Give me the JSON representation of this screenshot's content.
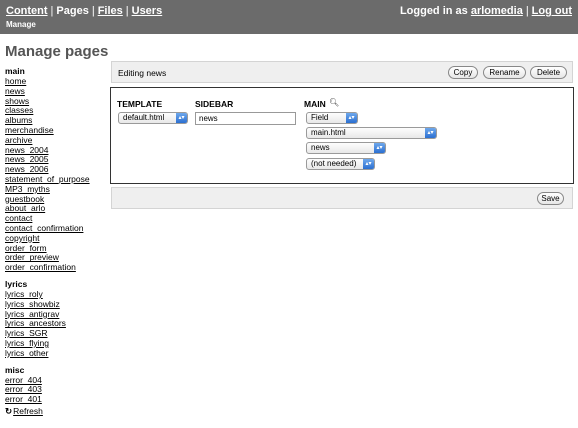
{
  "topbar": {
    "nav": {
      "content": "Content",
      "pages": "Pages",
      "files": "Files",
      "users": "Users",
      "sep": "|"
    },
    "sub": "Manage",
    "logged_in_prefix": "Logged in as",
    "username": "arlomedia",
    "logout": "Log out",
    "sep": "|"
  },
  "page_title": "Manage pages",
  "sidebar": {
    "groups": [
      {
        "title": "main",
        "items": [
          "home",
          "news",
          "shows",
          "classes",
          "albums",
          "merchandise",
          "archive",
          "news_2004",
          "news_2005",
          "news_2006",
          "statement_of_purpose",
          "MP3_myths",
          "guestbook",
          "about_arlo",
          "contact",
          "contact_confirmation",
          "copyright",
          "order_form",
          "order_preview",
          "order_confirmation"
        ]
      },
      {
        "title": "lyrics",
        "items": [
          "lyrics_roly",
          "lyrics_showbiz",
          "lyrics_antigrav",
          "lyrics_ancestors",
          "lyrics_SGR",
          "lyrics_flying",
          "lyrics_other"
        ]
      },
      {
        "title": "misc",
        "items": [
          "error_404",
          "error_403",
          "error_401"
        ]
      }
    ],
    "refresh_icon": "refresh-icon",
    "refresh_label": "Refresh"
  },
  "editor": {
    "heading": "Editing news",
    "copy_label": "Copy",
    "rename_label": "Rename",
    "delete_label": "Delete",
    "template_label": "TEMPLATE",
    "template_value": "default.html",
    "sidebar_label": "SIDEBAR",
    "sidebar_value": "news",
    "main_label": "MAIN",
    "main_icon": "magnifier-icon",
    "main_type_value": "Field",
    "main_file_value": "main.html",
    "main_page_value": "news",
    "main_extra_value": "(not needed)",
    "save_label": "Save"
  }
}
